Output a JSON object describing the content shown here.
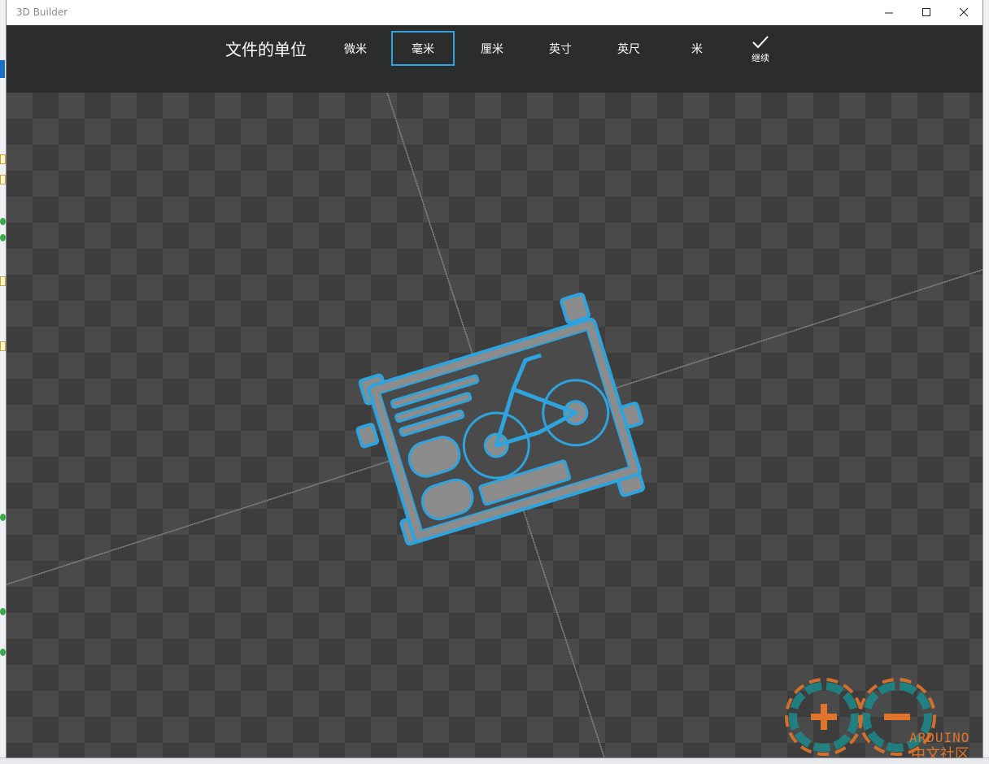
{
  "window": {
    "title": "3D Builder"
  },
  "window_controls": {
    "minimize": "minimize",
    "maximize": "maximize",
    "close": "close"
  },
  "header": {
    "title": "文件的单位"
  },
  "units": [
    {
      "label": "微米",
      "selected": false
    },
    {
      "label": "毫米",
      "selected": true
    },
    {
      "label": "厘米",
      "selected": false
    },
    {
      "label": "英寸",
      "selected": false
    },
    {
      "label": "英尺",
      "selected": false
    },
    {
      "label": "米",
      "selected": false
    }
  ],
  "continue": {
    "label": "继续",
    "icon": "checkmark-icon"
  },
  "watermark": {
    "text": "ARDUINO",
    "subtext": "中文社区"
  },
  "colors": {
    "accent": "#2fa3dd",
    "header_bg": "#2b2c2c",
    "viewport_bg": "#4a4a4a",
    "model": "#8c8c8c"
  }
}
